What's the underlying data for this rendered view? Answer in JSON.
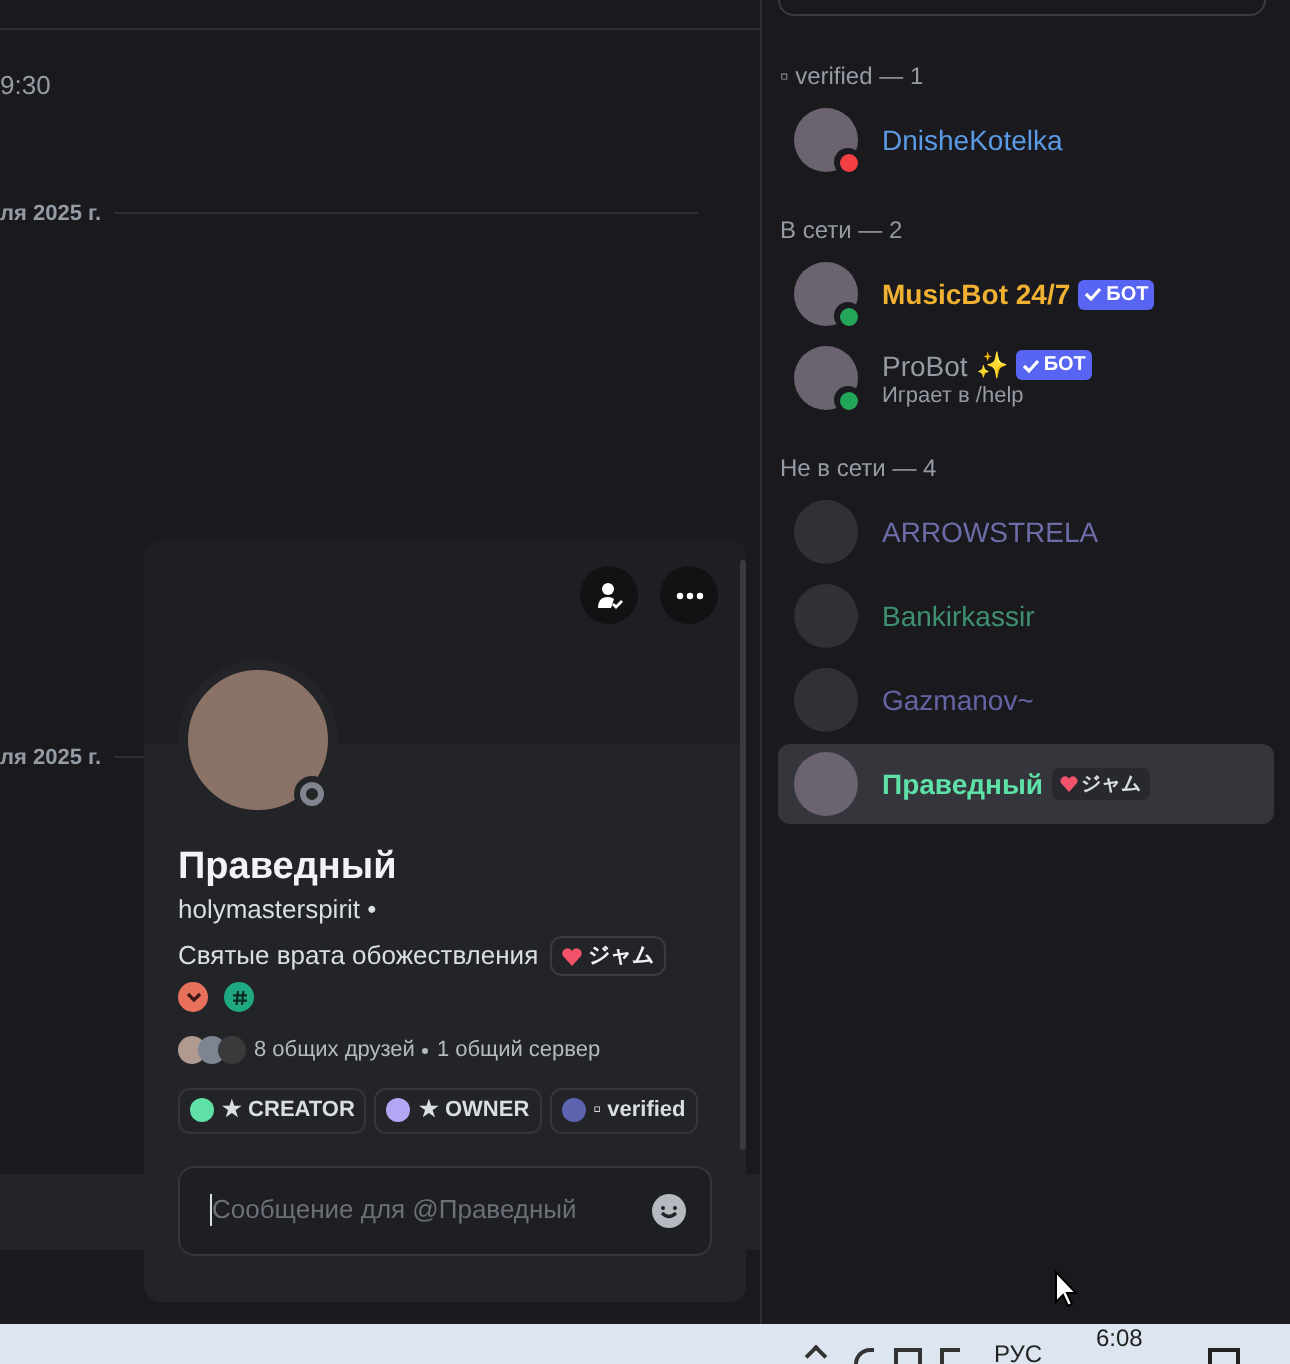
{
  "chat": {
    "timestamp": "9:30",
    "date_dividers": [
      "ля 2025 г.",
      "ля 2025 г."
    ]
  },
  "member_list": {
    "groups": [
      {
        "title": "▫ verified — 1",
        "members": [
          {
            "kind": "dnd",
            "name": "DnisheKotelka",
            "color": "#5b9be6",
            "selected": false
          }
        ]
      },
      {
        "title": "В сети — 2",
        "members": [
          {
            "kind": "online",
            "name": "MusicBot 24/7",
            "color": "#f0b132",
            "bot_badge": "БОТ",
            "selected": false
          },
          {
            "kind": "online",
            "name": "ProBot",
            "color": "#949ba4",
            "emoji": "✨",
            "bot_badge": "БОТ",
            "activity": "Играет в /help",
            "selected": false
          }
        ]
      },
      {
        "title": "Не в сети — 4",
        "members": [
          {
            "kind": "offline",
            "name": "ARROWSTRELA",
            "color": "#6c6ca8",
            "selected": false
          },
          {
            "kind": "offline",
            "name": "Bankirkassir",
            "color": "#3f9070",
            "selected": false
          },
          {
            "kind": "offline",
            "name": "Gazmanov~",
            "color": "#6464a4",
            "selected": false
          },
          {
            "kind": "plain",
            "name": "Праведный",
            "color": "#5ee0a6",
            "tag": "ジャム",
            "selected": true
          }
        ]
      }
    ]
  },
  "profile_popup": {
    "display_name": "Праведный",
    "username": "holymasterspirit",
    "username_suffix": "•",
    "bio": "Святые врата обожествления",
    "tag": "ジャム",
    "mutual_friends": "8 общих друзей",
    "mutual_servers": "1 общий сервер",
    "roles": [
      {
        "name": "★ CREATOR",
        "color": "#5ee0a6"
      },
      {
        "name": "★ OWNER",
        "color": "#b3a6f5"
      },
      {
        "name": "▫ verified",
        "color": "#5c64b0"
      }
    ],
    "message_placeholder": "Сообщение для @Праведный"
  },
  "taskbar": {
    "language": "РУС",
    "time": "6:08"
  }
}
